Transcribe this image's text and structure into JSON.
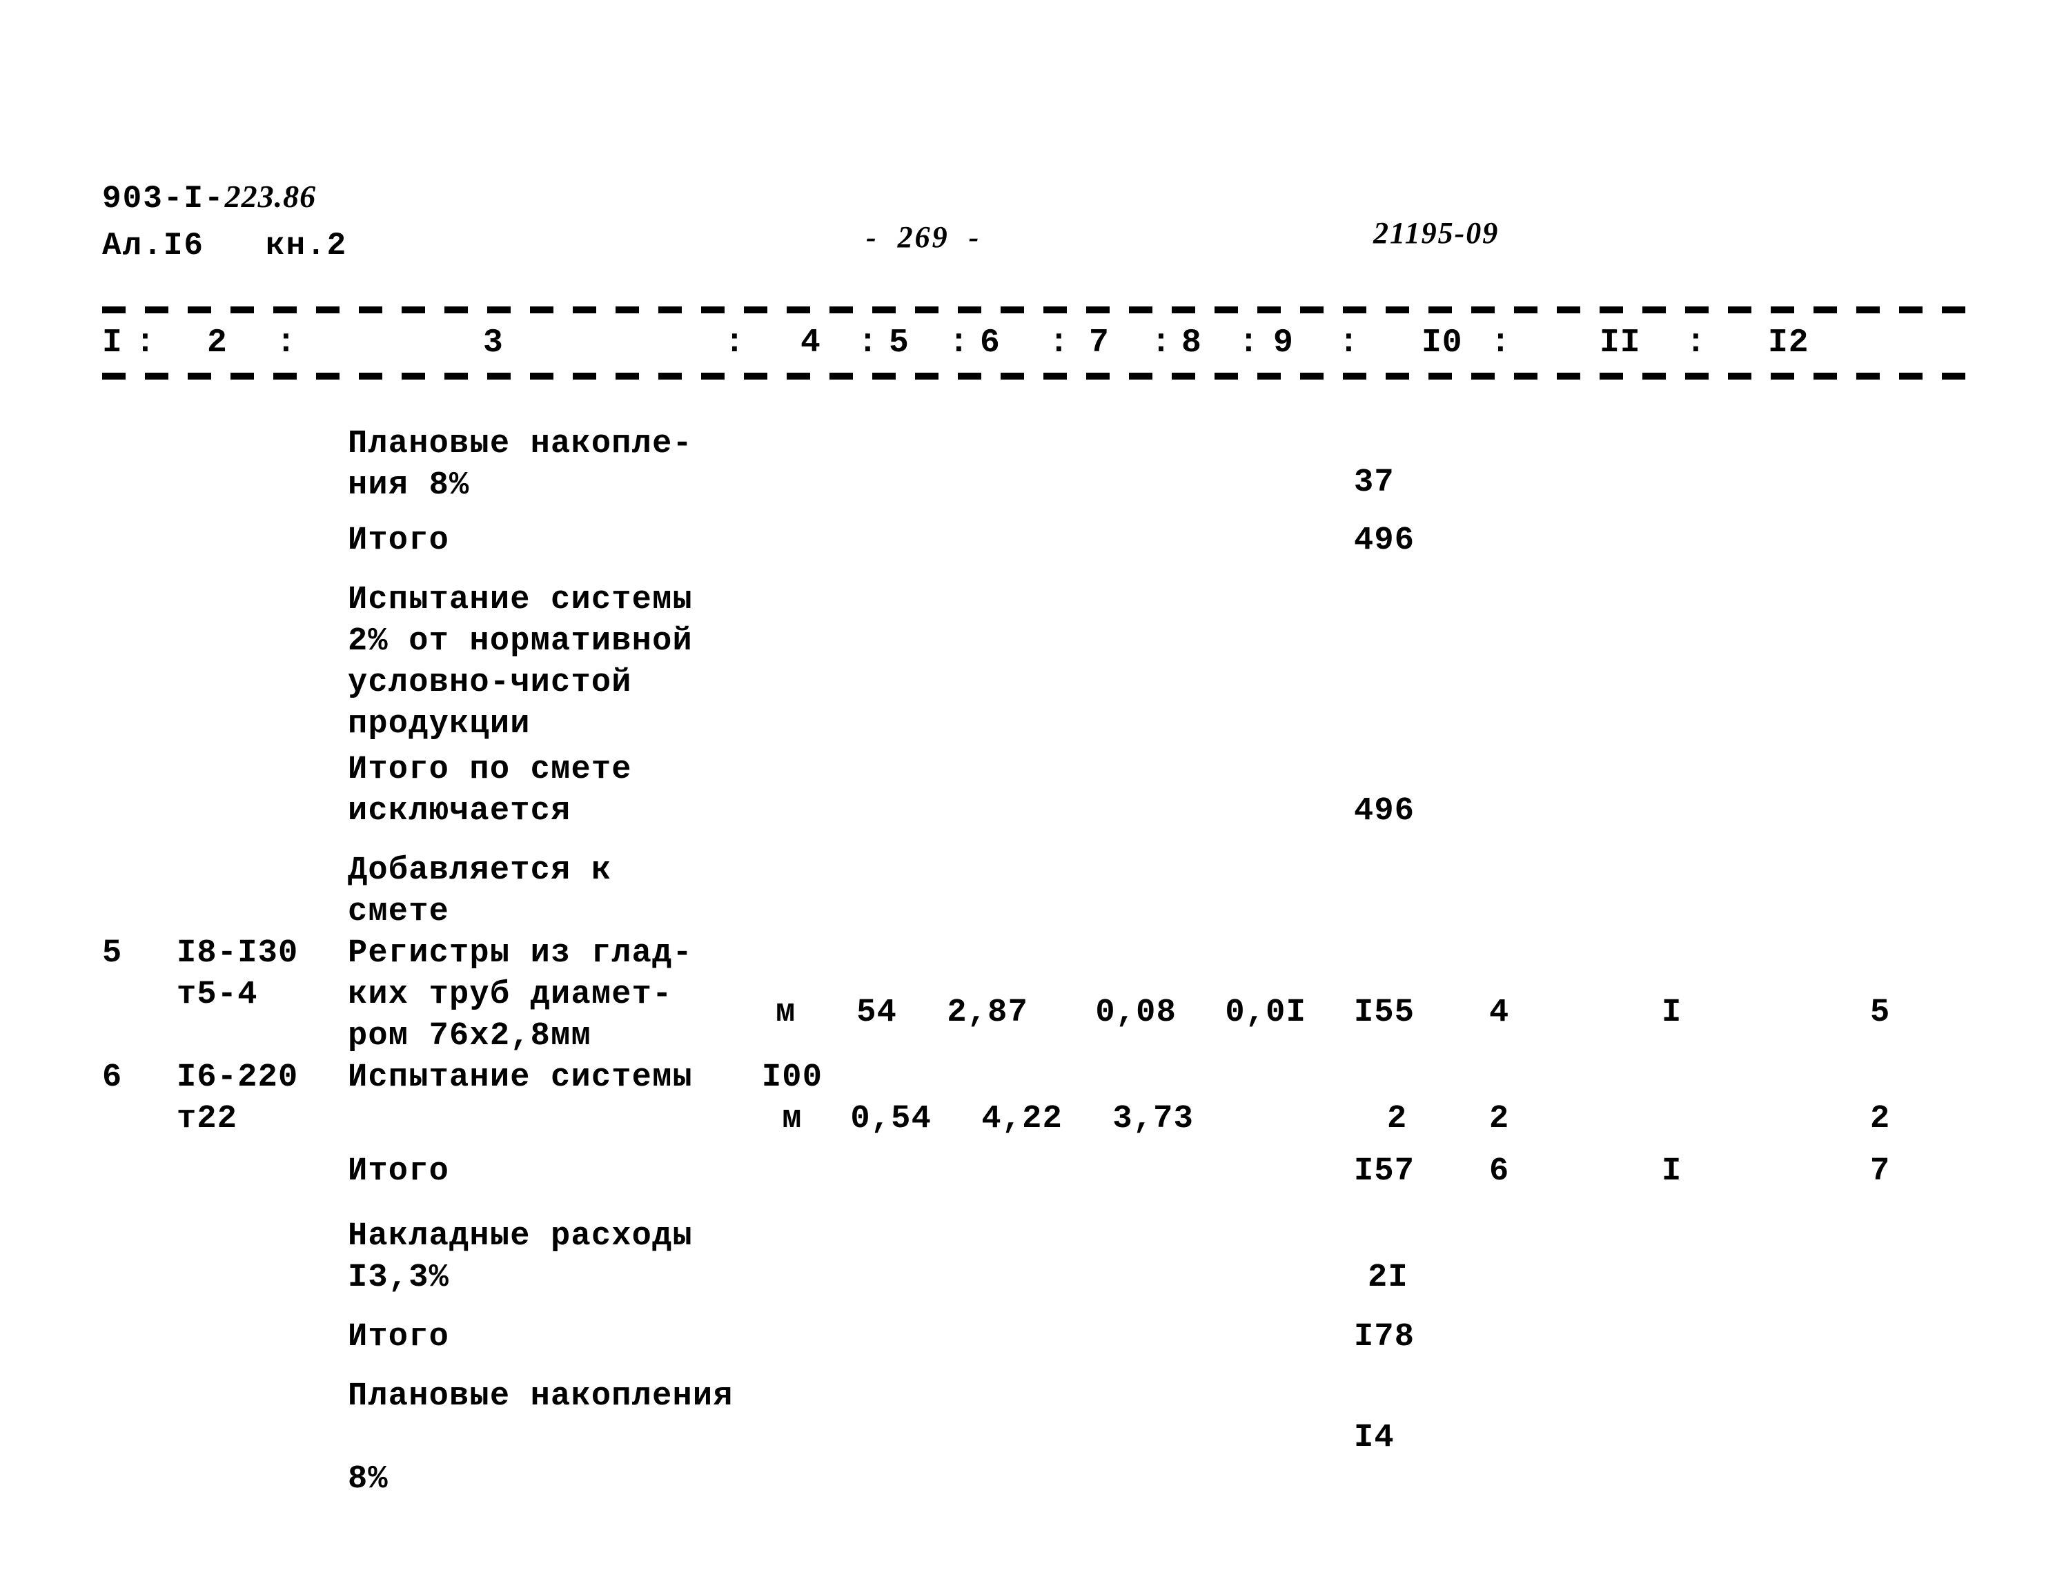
{
  "document": {
    "series_code_plain": "903-I-",
    "series_code_hand": "223.86",
    "album_line": "Ал.I6   кн.2",
    "page_number": "-  269  -",
    "sheet_code": "21195-09"
  },
  "table": {
    "column_numbers": [
      "I",
      "2",
      "3",
      "4",
      "5",
      "6",
      "7",
      "8",
      "9",
      "I0",
      "II",
      "I2"
    ],
    "separator": ":",
    "rows": [
      {
        "no": "",
        "code": "",
        "description": "Плановые накопле-\nния 8%",
        "unit": "",
        "c4": "",
        "c5": "",
        "c6": "",
        "c7": "",
        "c8": "",
        "c9": "37",
        "c10": "",
        "c11": "",
        "c12": ""
      },
      {
        "no": "",
        "code": "",
        "description": "Итого",
        "unit": "",
        "c4": "",
        "c5": "",
        "c6": "",
        "c7": "",
        "c8": "",
        "c9": "496",
        "c10": "",
        "c11": "",
        "c12": ""
      },
      {
        "no": "",
        "code": "",
        "description": "Испытание системы\n 2% от нормативной\nусловно-чистой\nпродукции",
        "unit": "",
        "c4": "",
        "c5": "",
        "c6": "",
        "c7": "",
        "c8": "",
        "c9": "",
        "c10": "",
        "c11": "",
        "c12": ""
      },
      {
        "no": "",
        "code": "",
        "description": "Итого по смете\nисключается",
        "unit": "",
        "c4": "",
        "c5": "",
        "c6": "",
        "c7": "",
        "c8": "",
        "c9": "496",
        "c10": "",
        "c11": "",
        "c12": ""
      },
      {
        "no": "",
        "code": "",
        "description": " Добавляется к\n смете",
        "unit": "",
        "c4": "",
        "c5": "",
        "c6": "",
        "c7": "",
        "c8": "",
        "c9": "",
        "c10": "",
        "c11": "",
        "c12": ""
      },
      {
        "no": "5",
        "code": "I8-I30\n  т5-4",
        "description": "Регистры из глад-\nких труб диамет-\nром 76х2,8мм",
        "unit": "м",
        "c4": "54",
        "c5": "2,87",
        "c6": "0,08",
        "c7": "0,0I",
        "c8": "",
        "c9": "I55",
        "c10": "4",
        "c11": "I",
        "c12": "5"
      },
      {
        "no": "6",
        "code": "I6-220\n  т22",
        "description": "Испытание системы",
        "unit": "I00\n м",
        "c4": "0,54",
        "c5": "4,22",
        "c6": "3,73",
        "c7": "",
        "c8": "",
        "c9": "2",
        "c10": "2",
        "c11": "",
        "c12": "2"
      },
      {
        "no": "",
        "code": "",
        "description": "Итого",
        "unit": "",
        "c4": "",
        "c5": "",
        "c6": "",
        "c7": "",
        "c8": "",
        "c9": "I57",
        "c10": "6",
        "c11": "I",
        "c12": "7"
      },
      {
        "no": "",
        "code": "",
        "description": "Накладные расходы\nI3,3%",
        "unit": "",
        "c4": "",
        "c5": "",
        "c6": "",
        "c7": "",
        "c8": "",
        "c9": "2I",
        "c10": "",
        "c11": "",
        "c12": ""
      },
      {
        "no": "",
        "code": "",
        "description": "Итого",
        "unit": "",
        "c4": "",
        "c5": "",
        "c6": "",
        "c7": "",
        "c8": "",
        "c9": "I78",
        "c10": "",
        "c11": "",
        "c12": ""
      },
      {
        "no": "",
        "code": "",
        "description": "Плановые накопления\n\n8%",
        "unit": "",
        "c4": "",
        "c5": "",
        "c6": "",
        "c7": "",
        "c8": "",
        "c9": "I4",
        "c10": "",
        "c11": "",
        "c12": ""
      }
    ]
  }
}
